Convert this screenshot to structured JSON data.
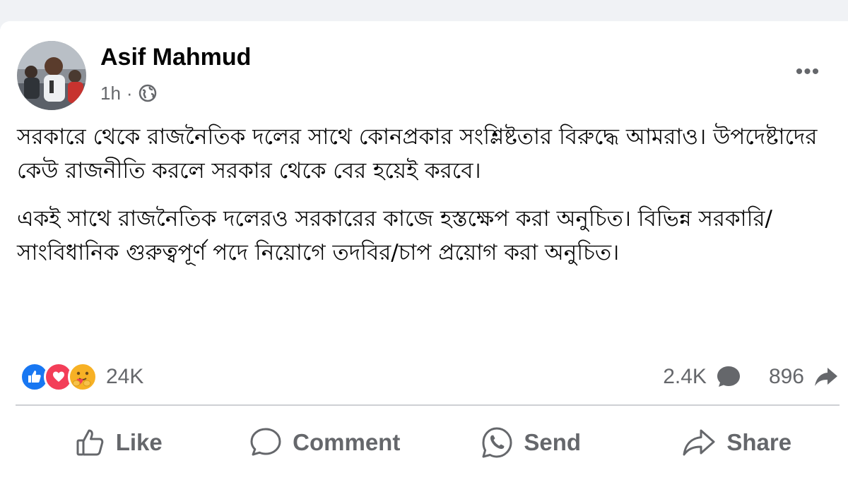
{
  "post": {
    "author": "Asif Mahmud",
    "time": "1h",
    "separator": "·",
    "more_label": "•••",
    "paragraphs": [
      "সরকারে থেকে রাজনৈতিক দলের সাথে কোনপ্রকার সংশ্লিষ্টতার বিরুদ্ধে আমরাও। উপদেষ্টাদের কেউ রাজনীতি করলে সরকার থেকে বের হয়েই করবে।",
      "একই সাথে রাজনৈতিক দলেরও সরকারের কাজে হস্তক্ষেপ করা অনুচিত। বিভিন্ন সরকারি/সাংবিধানিক গুরুত্বপূর্ণ পদে নিয়োগে তদবির/চাপ প্রয়োগ করা অনুচিত।"
    ]
  },
  "stats": {
    "reaction_icons": [
      "like-icon",
      "love-icon",
      "care-icon"
    ],
    "reactions_count": "24K",
    "comments_count": "2.4K",
    "shares_count": "896"
  },
  "actions": {
    "like": "Like",
    "comment": "Comment",
    "send": "Send",
    "share": "Share"
  },
  "colors": {
    "like_blue": "#1877f2",
    "love_red": "#f33e58",
    "care_yellow": "#f7b125",
    "secondary_text": "#65676b"
  }
}
